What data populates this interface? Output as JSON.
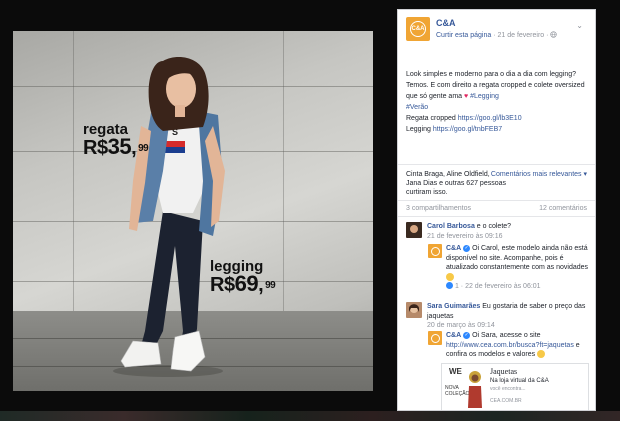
{
  "photo": {
    "shirt_text": "S",
    "regata": {
      "name": "regata",
      "currency": "R$",
      "amount": "35",
      "cents": "99"
    },
    "legging": {
      "name": "legging",
      "currency": "R$",
      "amount": "69",
      "cents": "99"
    }
  },
  "post": {
    "page_logo_text": "C&A",
    "page_name": "C&A",
    "like_page": "Curtir esta página",
    "date": " · 21 de fevereiro · ",
    "globe_icon": "globe-icon",
    "chevron": "⌄",
    "text_1": "Look simples e moderno para o dia a dia com legging? Temos. E com direito a regata cropped e colete oversized que só gente ama ",
    "heart": "♥",
    "hashtag_legging": " #Legging",
    "hashtag_verao": "#Verão",
    "regata_line_label": "Regata cropped ",
    "regata_link": "https://goo.gl/lb3E10",
    "legging_line_label": "Legging ",
    "legging_link": "https://goo.gl/tnbFEB7"
  },
  "reactions": {
    "likes": "Cinta Braga, Aline Oldfield, Jana Dias e outras 627 pessoas curtiram isso.",
    "most_relevant": "Comentários mais relevantes ▾",
    "shares": "3 compartilhamentos",
    "comments": "12 comentários"
  },
  "comments": [
    {
      "author": "Carol Barbosa",
      "text": " e o colete?",
      "meta": "21 de fevereiro às 09:16"
    },
    {
      "author": "C&A",
      "text": " Oi Carol, este modelo ainda não está disponível no site. Acompanhe, pois é atualizado constantemente com as novidades ",
      "meta": "1 · 22 de fevereiro às 06:01",
      "badge": "✓"
    },
    {
      "author": "Sara Guimarães",
      "text": " Eu gostaria de saber o preço das jaquetas",
      "meta": "20 de março às 09:14"
    },
    {
      "author": "C&A",
      "text": " Oi Sara, acesse o site ",
      "link": "http://www.cea.com.br/busca?ft=jaquetas",
      "text_after": " e confira os modelos e valores ",
      "badge": "✓"
    }
  ],
  "preview": {
    "badge": "WE",
    "caption": "NOVA COLEÇÃO",
    "title": "Jaquetas",
    "desc": "Na loja virtual da C&A",
    "sub": "você encontra...",
    "domain": "CEA.COM.BR"
  }
}
